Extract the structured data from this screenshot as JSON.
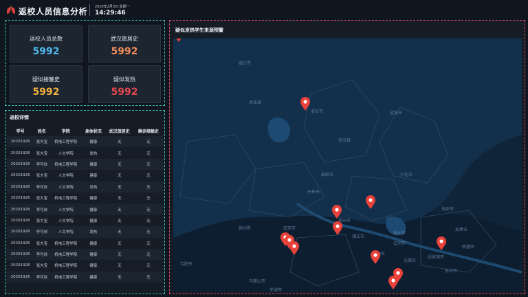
{
  "app": {
    "title": "返校人员信息分析",
    "date": "2020年2月3日 星期一",
    "time": "14:29:46"
  },
  "stats": [
    {
      "label": "返校人员总数",
      "value": "5992",
      "color": "#4fb8ea"
    },
    {
      "label": "武汉旅居史",
      "value": "5992",
      "color": "#f08c5a"
    },
    {
      "label": "疑似接触史",
      "value": "5992",
      "color": "#f5b33c"
    },
    {
      "label": "疑似发热",
      "value": "5992",
      "color": "#e8474f"
    }
  ],
  "table": {
    "title": "返校详情",
    "columns": [
      "学号",
      "姓名",
      "学院",
      "身体状况",
      "武汉旅居史",
      "确诊接触史"
    ],
    "rows": [
      [
        "20201926",
        "张大宝",
        "机电工程学院",
        "健康",
        "无",
        "无"
      ],
      [
        "20201926",
        "张大宝",
        "人文学院",
        "发热",
        "无",
        "无"
      ],
      [
        "20201926",
        "李可欣",
        "机电工程学院",
        "健康",
        "无",
        "无"
      ],
      [
        "20201926",
        "张大宝",
        "人文学院",
        "健康",
        "无",
        "无"
      ],
      [
        "20201926",
        "李可欣",
        "人文学院",
        "发热",
        "无",
        "无"
      ],
      [
        "20201926",
        "张大宝",
        "机电工程学院",
        "健康",
        "无",
        "无"
      ],
      [
        "20201926",
        "李可欣",
        "人文学院",
        "健康",
        "无",
        "无"
      ],
      [
        "20201926",
        "张大宝",
        "人文学院",
        "健康",
        "无",
        "无"
      ],
      [
        "20201926",
        "李可欣",
        "人文学院",
        "发热",
        "无",
        "无"
      ],
      [
        "20201926",
        "张大宝",
        "机电工程学院",
        "健康",
        "无",
        "无"
      ],
      [
        "20201926",
        "李可欣",
        "机电工程学院",
        "健康",
        "无",
        "无"
      ],
      [
        "20201926",
        "张大宝",
        "机电工程学院",
        "健康",
        "无",
        "无"
      ],
      [
        "20201926",
        "李可欣",
        "机电工程学院",
        "健康",
        "无",
        "无"
      ]
    ]
  },
  "map": {
    "title": "疑似发热学生来源预警",
    "marker_color": "#e8423a",
    "labels": [
      "宿迁市",
      "淮安市",
      "洪泽湖",
      "盐城市",
      "扬州市",
      "泰州市",
      "镇江市",
      "南京市",
      "合肥市",
      "马鞍山市",
      "芜湖市",
      "南通市",
      "常州市",
      "无锡市",
      "苏州市",
      "滁州市",
      "天长市",
      "高邮市",
      "宝应县",
      "兴化市",
      "江阴市",
      "张家港市",
      "如皋市",
      "海安市"
    ],
    "markers": 11
  }
}
